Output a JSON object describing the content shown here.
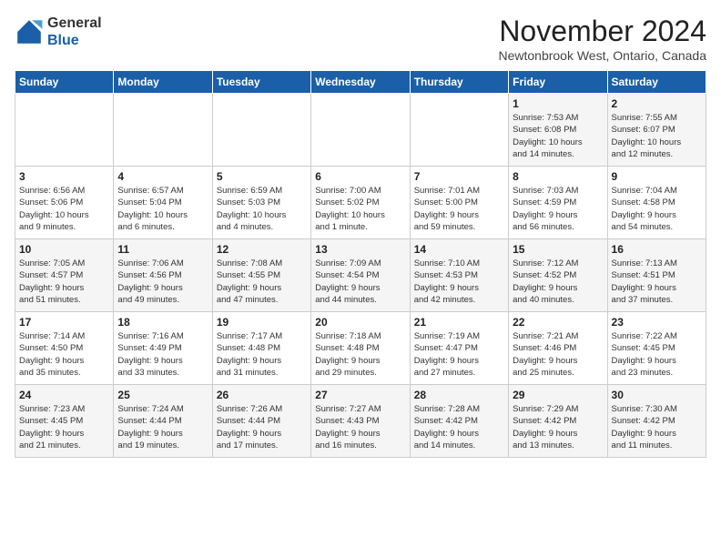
{
  "logo": {
    "general": "General",
    "blue": "Blue"
  },
  "title": "November 2024",
  "location": "Newtonbrook West, Ontario, Canada",
  "days_of_week": [
    "Sunday",
    "Monday",
    "Tuesday",
    "Wednesday",
    "Thursday",
    "Friday",
    "Saturday"
  ],
  "weeks": [
    [
      {
        "day": "",
        "info": ""
      },
      {
        "day": "",
        "info": ""
      },
      {
        "day": "",
        "info": ""
      },
      {
        "day": "",
        "info": ""
      },
      {
        "day": "",
        "info": ""
      },
      {
        "day": "1",
        "info": "Sunrise: 7:53 AM\nSunset: 6:08 PM\nDaylight: 10 hours\nand 14 minutes."
      },
      {
        "day": "2",
        "info": "Sunrise: 7:55 AM\nSunset: 6:07 PM\nDaylight: 10 hours\nand 12 minutes."
      }
    ],
    [
      {
        "day": "3",
        "info": "Sunrise: 6:56 AM\nSunset: 5:06 PM\nDaylight: 10 hours\nand 9 minutes."
      },
      {
        "day": "4",
        "info": "Sunrise: 6:57 AM\nSunset: 5:04 PM\nDaylight: 10 hours\nand 6 minutes."
      },
      {
        "day": "5",
        "info": "Sunrise: 6:59 AM\nSunset: 5:03 PM\nDaylight: 10 hours\nand 4 minutes."
      },
      {
        "day": "6",
        "info": "Sunrise: 7:00 AM\nSunset: 5:02 PM\nDaylight: 10 hours\nand 1 minute."
      },
      {
        "day": "7",
        "info": "Sunrise: 7:01 AM\nSunset: 5:00 PM\nDaylight: 9 hours\nand 59 minutes."
      },
      {
        "day": "8",
        "info": "Sunrise: 7:03 AM\nSunset: 4:59 PM\nDaylight: 9 hours\nand 56 minutes."
      },
      {
        "day": "9",
        "info": "Sunrise: 7:04 AM\nSunset: 4:58 PM\nDaylight: 9 hours\nand 54 minutes."
      }
    ],
    [
      {
        "day": "10",
        "info": "Sunrise: 7:05 AM\nSunset: 4:57 PM\nDaylight: 9 hours\nand 51 minutes."
      },
      {
        "day": "11",
        "info": "Sunrise: 7:06 AM\nSunset: 4:56 PM\nDaylight: 9 hours\nand 49 minutes."
      },
      {
        "day": "12",
        "info": "Sunrise: 7:08 AM\nSunset: 4:55 PM\nDaylight: 9 hours\nand 47 minutes."
      },
      {
        "day": "13",
        "info": "Sunrise: 7:09 AM\nSunset: 4:54 PM\nDaylight: 9 hours\nand 44 minutes."
      },
      {
        "day": "14",
        "info": "Sunrise: 7:10 AM\nSunset: 4:53 PM\nDaylight: 9 hours\nand 42 minutes."
      },
      {
        "day": "15",
        "info": "Sunrise: 7:12 AM\nSunset: 4:52 PM\nDaylight: 9 hours\nand 40 minutes."
      },
      {
        "day": "16",
        "info": "Sunrise: 7:13 AM\nSunset: 4:51 PM\nDaylight: 9 hours\nand 37 minutes."
      }
    ],
    [
      {
        "day": "17",
        "info": "Sunrise: 7:14 AM\nSunset: 4:50 PM\nDaylight: 9 hours\nand 35 minutes."
      },
      {
        "day": "18",
        "info": "Sunrise: 7:16 AM\nSunset: 4:49 PM\nDaylight: 9 hours\nand 33 minutes."
      },
      {
        "day": "19",
        "info": "Sunrise: 7:17 AM\nSunset: 4:48 PM\nDaylight: 9 hours\nand 31 minutes."
      },
      {
        "day": "20",
        "info": "Sunrise: 7:18 AM\nSunset: 4:48 PM\nDaylight: 9 hours\nand 29 minutes."
      },
      {
        "day": "21",
        "info": "Sunrise: 7:19 AM\nSunset: 4:47 PM\nDaylight: 9 hours\nand 27 minutes."
      },
      {
        "day": "22",
        "info": "Sunrise: 7:21 AM\nSunset: 4:46 PM\nDaylight: 9 hours\nand 25 minutes."
      },
      {
        "day": "23",
        "info": "Sunrise: 7:22 AM\nSunset: 4:45 PM\nDaylight: 9 hours\nand 23 minutes."
      }
    ],
    [
      {
        "day": "24",
        "info": "Sunrise: 7:23 AM\nSunset: 4:45 PM\nDaylight: 9 hours\nand 21 minutes."
      },
      {
        "day": "25",
        "info": "Sunrise: 7:24 AM\nSunset: 4:44 PM\nDaylight: 9 hours\nand 19 minutes."
      },
      {
        "day": "26",
        "info": "Sunrise: 7:26 AM\nSunset: 4:44 PM\nDaylight: 9 hours\nand 17 minutes."
      },
      {
        "day": "27",
        "info": "Sunrise: 7:27 AM\nSunset: 4:43 PM\nDaylight: 9 hours\nand 16 minutes."
      },
      {
        "day": "28",
        "info": "Sunrise: 7:28 AM\nSunset: 4:42 PM\nDaylight: 9 hours\nand 14 minutes."
      },
      {
        "day": "29",
        "info": "Sunrise: 7:29 AM\nSunset: 4:42 PM\nDaylight: 9 hours\nand 13 minutes."
      },
      {
        "day": "30",
        "info": "Sunrise: 7:30 AM\nSunset: 4:42 PM\nDaylight: 9 hours\nand 11 minutes."
      }
    ]
  ]
}
